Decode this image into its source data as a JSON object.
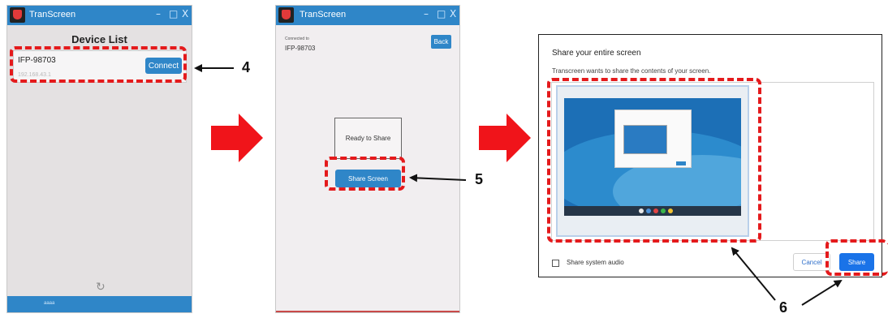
{
  "panel1": {
    "window_title": "TranScreen",
    "controls": {
      "minimize": "–",
      "maximize": "□",
      "close": "X"
    },
    "heading": "Device List",
    "device": {
      "name": "IFP-98703",
      "ip": "192.168.43.1",
      "connect_label": "Connect"
    },
    "refresh_icon": "↻",
    "footer_text": "aaaa"
  },
  "panel2": {
    "window_title": "TranScreen",
    "controls": {
      "minimize": "–",
      "maximize": "□",
      "close": "X"
    },
    "connected_label": "Connected to",
    "connected_device": "IFP-98703",
    "back_label": "Back",
    "ready_text": "Ready to Share",
    "share_screen_label": "Share Screen"
  },
  "panel3": {
    "title": "Share your entire screen",
    "subtitle": "Transcreen wants to share the contents of your screen.",
    "audio_label": "Share system audio",
    "cancel_label": "Cancel",
    "share_label": "Share"
  },
  "annotations": {
    "step4": "4",
    "step5": "5",
    "step6": "6"
  },
  "colors": {
    "accent": "#2f86c8",
    "share_blue": "#1a73e8",
    "highlight_red": "#e41a1c"
  }
}
